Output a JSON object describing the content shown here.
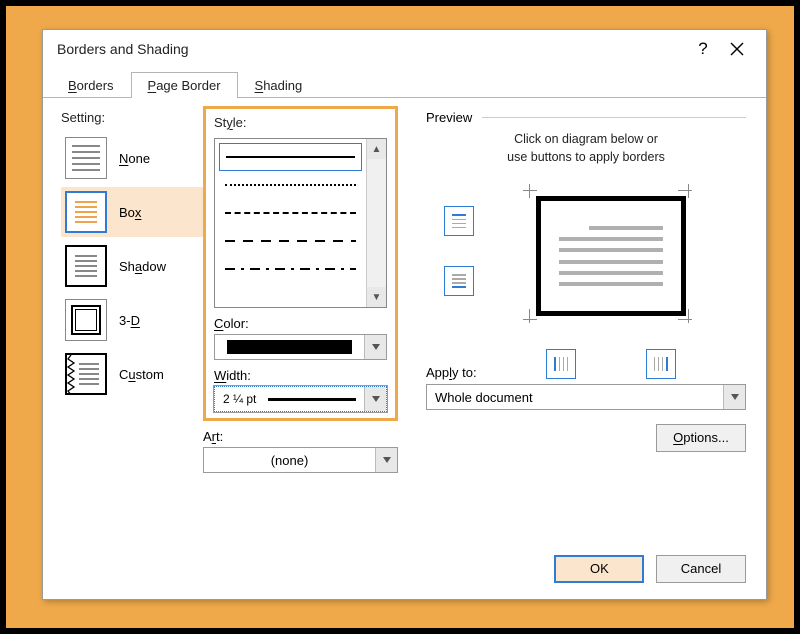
{
  "dialog": {
    "title": "Borders and Shading",
    "help": "?",
    "close": "×"
  },
  "tabs": {
    "borders": "Borders",
    "page_border": "Page Border",
    "shading": "Shading"
  },
  "setting": {
    "label": "Setting:",
    "none": "None",
    "box": "Box",
    "shadow": "Shadow",
    "three_d": "3-D",
    "custom": "Custom"
  },
  "style": {
    "label": "Style:"
  },
  "color": {
    "label": "Color:"
  },
  "width": {
    "label": "Width:",
    "value": "2 ¼ pt"
  },
  "art": {
    "label": "Art:",
    "value": "(none)"
  },
  "preview": {
    "label": "Preview",
    "hint_line1": "Click on diagram below or",
    "hint_line2": "use buttons to apply borders"
  },
  "apply_to": {
    "label": "Apply to:",
    "value": "Whole document"
  },
  "buttons": {
    "options": "Options...",
    "ok": "OK",
    "cancel": "Cancel"
  }
}
